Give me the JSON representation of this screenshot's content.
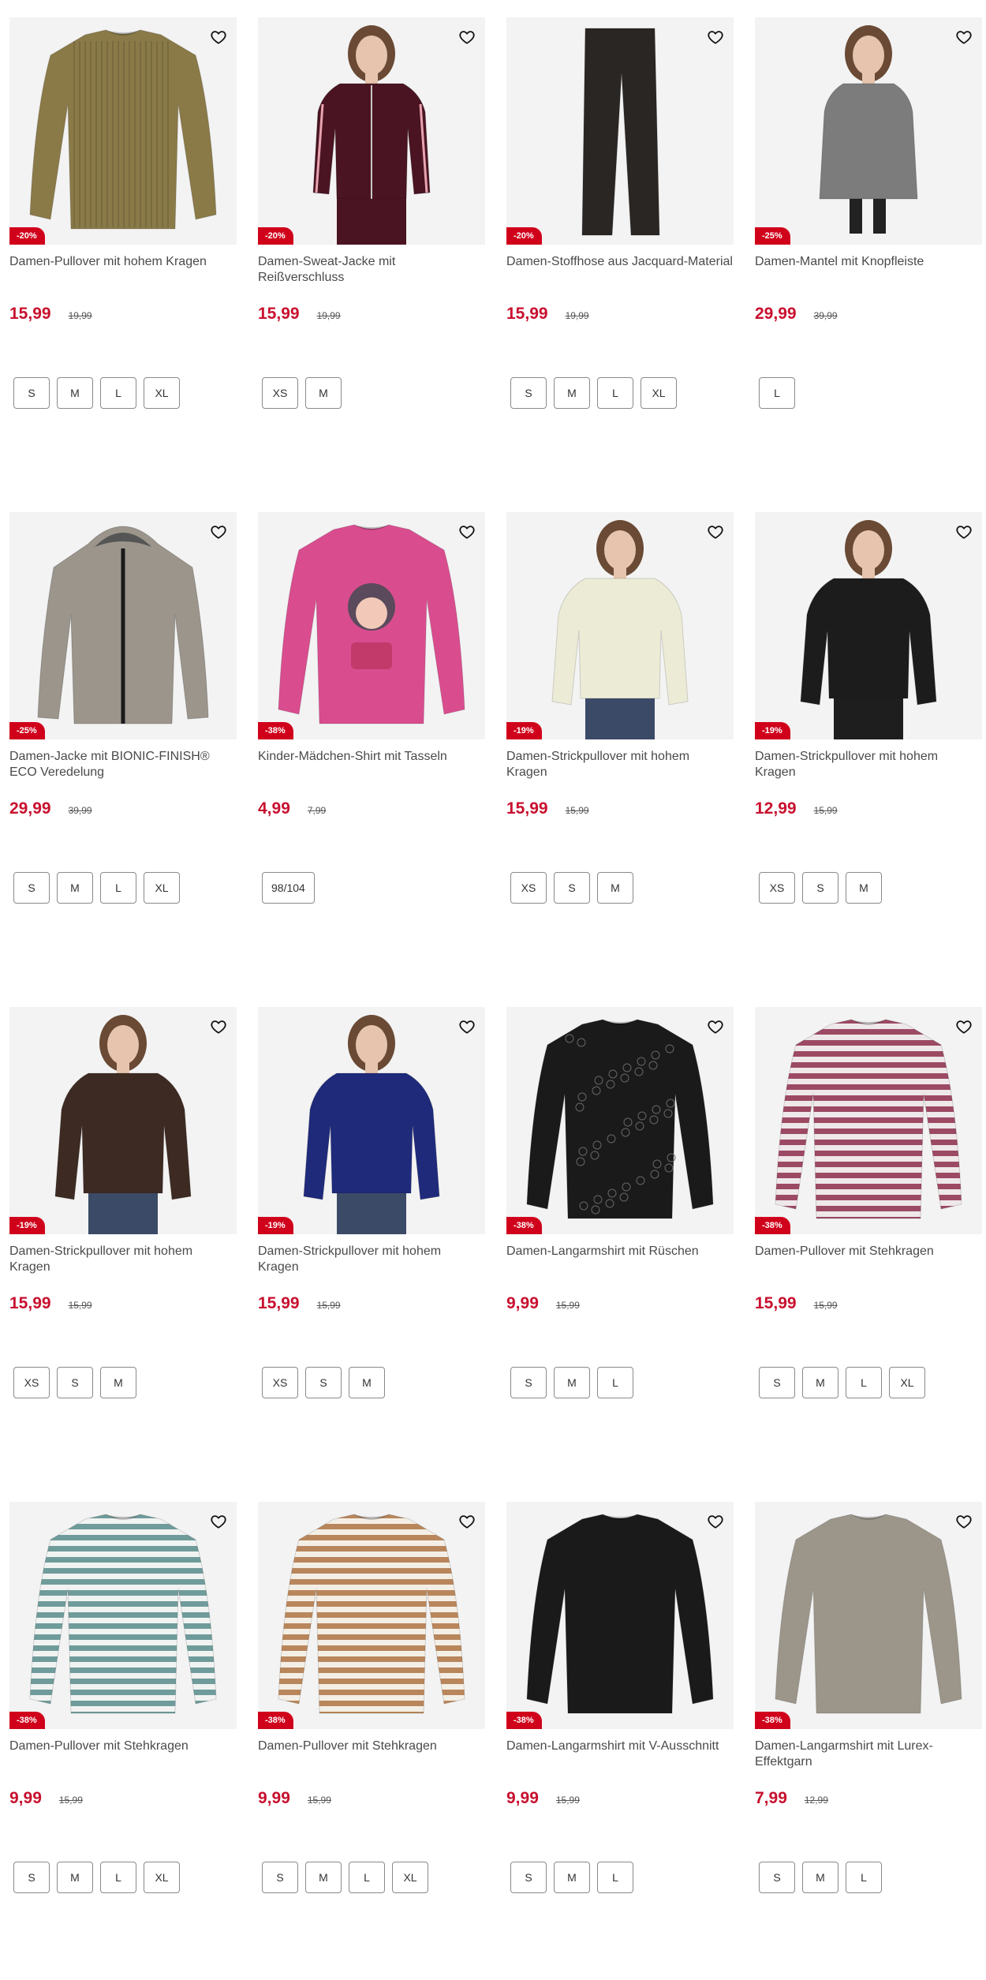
{
  "colors": {
    "price": "#c8102e",
    "badge": "#d0021b",
    "image_bg": "#f3f3f3"
  },
  "products": [
    {
      "title": "Damen-Pullover mit hohem Kragen",
      "discount": "-20%",
      "price": "15,99",
      "old_price": "19,99",
      "sizes": [
        "S",
        "M",
        "L",
        "XL"
      ],
      "art": "sweater",
      "color": "#8a7a48",
      "pattern": "rib"
    },
    {
      "title": "Damen-Sweat-Jacke mit Reißverschluss",
      "discount": "-20%",
      "price": "15,99",
      "old_price": "19,99",
      "sizes": [
        "XS",
        "M"
      ],
      "art": "jacket-model",
      "color": "#4a1422",
      "pattern": "stripe-sleeve"
    },
    {
      "title": "Damen-Stoffhose aus Jacquard-Material",
      "discount": "-20%",
      "price": "15,99",
      "old_price": "19,99",
      "sizes": [
        "S",
        "M",
        "L",
        "XL"
      ],
      "art": "pants",
      "color": "#2a2624",
      "pattern": "none"
    },
    {
      "title": "Damen-Mantel mit Knopfleiste",
      "discount": "-25%",
      "price": "29,99",
      "old_price": "39,99",
      "sizes": [
        "L"
      ],
      "art": "coat-model",
      "color": "#7c7c7c",
      "pattern": "none"
    },
    {
      "title": "Damen-Jacke mit BIONIC-FINISH® ECO Veredelung",
      "discount": "-25%",
      "price": "29,99",
      "old_price": "39,99",
      "sizes": [
        "S",
        "M",
        "L",
        "XL"
      ],
      "art": "hoodie-jacket",
      "color": "#9b958b",
      "pattern": "zip"
    },
    {
      "title": "Kinder-Mädchen-Shirt mit Tasseln",
      "discount": "-38%",
      "price": "4,99",
      "old_price": "7,99",
      "sizes": [
        "98/104"
      ],
      "art": "sweater",
      "color": "#d94d8f",
      "pattern": "print"
    },
    {
      "title": "Damen-Strickpullover mit hohem Kragen",
      "discount": "-19%",
      "price": "15,99",
      "old_price": "15,99",
      "sizes": [
        "XS",
        "S",
        "M"
      ],
      "art": "model",
      "color": "#ecebd6",
      "pattern": "none"
    },
    {
      "title": "Damen-Strickpullover mit hohem Kragen",
      "discount": "-19%",
      "price": "12,99",
      "old_price": "15,99",
      "sizes": [
        "XS",
        "S",
        "M"
      ],
      "art": "model",
      "color": "#1c1c1c",
      "pattern": "none"
    },
    {
      "title": "Damen-Strickpullover mit hohem Kragen",
      "discount": "-19%",
      "price": "15,99",
      "old_price": "15,99",
      "sizes": [
        "XS",
        "S",
        "M"
      ],
      "art": "model",
      "color": "#3d2a22",
      "pattern": "none"
    },
    {
      "title": "Damen-Strickpullover mit hohem Kragen",
      "discount": "-19%",
      "price": "15,99",
      "old_price": "15,99",
      "sizes": [
        "XS",
        "S",
        "M"
      ],
      "art": "model",
      "color": "#1f2a7a",
      "pattern": "none"
    },
    {
      "title": "Damen-Langarmshirt mit Rüschen",
      "discount": "-38%",
      "price": "9,99",
      "old_price": "15,99",
      "sizes": [
        "S",
        "M",
        "L"
      ],
      "art": "blouse",
      "color": "#1a1a1a",
      "pattern": "lace"
    },
    {
      "title": "Damen-Pullover mit Stehkragen",
      "discount": "-38%",
      "price": "15,99",
      "old_price": "15,99",
      "sizes": [
        "S",
        "M",
        "L",
        "XL"
      ],
      "art": "sweater",
      "color": "#e8dfe2",
      "pattern": "stripes-pink"
    },
    {
      "title": "Damen-Pullover mit Stehkragen",
      "discount": "-38%",
      "price": "9,99",
      "old_price": "15,99",
      "sizes": [
        "S",
        "M",
        "L",
        "XL"
      ],
      "art": "sweater",
      "color": "#f0f2f0",
      "pattern": "stripes-teal"
    },
    {
      "title": "Damen-Pullover mit Stehkragen",
      "discount": "-38%",
      "price": "9,99",
      "old_price": "15,99",
      "sizes": [
        "S",
        "M",
        "L",
        "XL"
      ],
      "art": "sweater",
      "color": "#f3ede4",
      "pattern": "stripes-tan"
    },
    {
      "title": "Damen-Langarmshirt mit V-Ausschnitt",
      "discount": "-38%",
      "price": "9,99",
      "old_price": "15,99",
      "sizes": [
        "S",
        "M",
        "L"
      ],
      "art": "blouse",
      "color": "#1a1a1a",
      "pattern": "none"
    },
    {
      "title": "Damen-Langarmshirt mit Lurex-Effektgarn",
      "discount": "-38%",
      "price": "7,99",
      "old_price": "12,99",
      "sizes": [
        "S",
        "M",
        "L"
      ],
      "art": "sweater",
      "color": "#9c968a",
      "pattern": "none"
    }
  ]
}
